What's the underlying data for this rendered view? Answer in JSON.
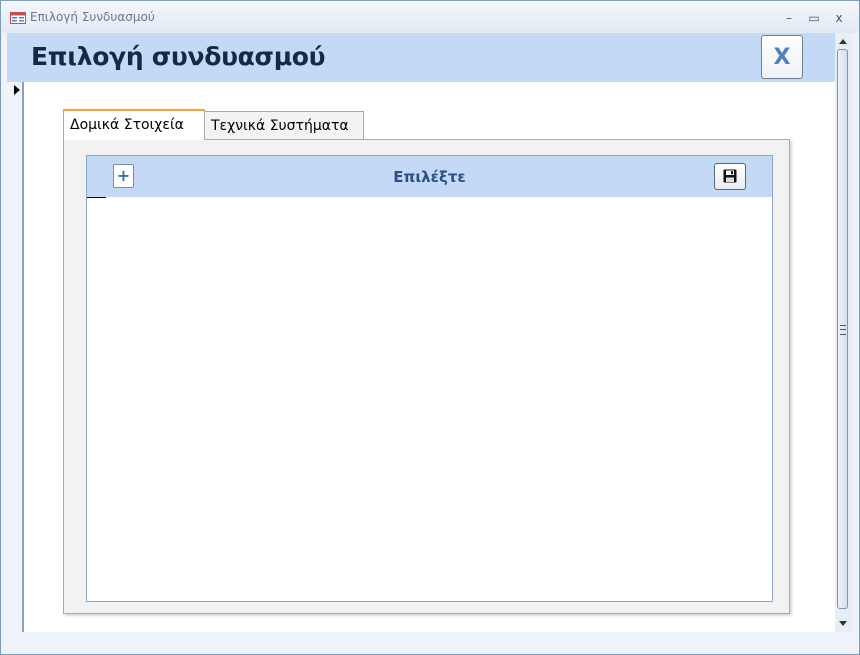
{
  "window": {
    "title": "Επιλογή Συνδυασμού",
    "minimize_glyph": "–",
    "maximize_glyph": "▭",
    "close_glyph": "x"
  },
  "form": {
    "title": "Επιλογή συνδυασμού",
    "close_button_label": "X"
  },
  "tabs": [
    {
      "label": "Δομικά Στοιχεία",
      "active": true
    },
    {
      "label": "Τεχνικά Συστήματα",
      "active": false
    }
  ],
  "subform": {
    "title": "Επιλέξτε",
    "add_button_label": "+",
    "save_icon": "save-icon",
    "rows": []
  },
  "colors": {
    "header_band": "#c4d9f5",
    "active_tab_accent": "#f3a33c",
    "title_text": "#14284a",
    "subform_title_text": "#2c4f86"
  }
}
